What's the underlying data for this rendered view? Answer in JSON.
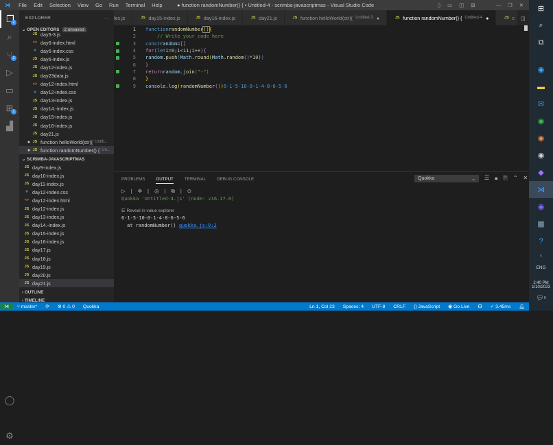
{
  "titlebar": {
    "menus": [
      "File",
      "Edit",
      "Selection",
      "View",
      "Go",
      "Run",
      "Terminal",
      "Help"
    ],
    "title": "● function randomNumber() { • Untitled-4 - scrimba-javascriptmas - Visual Studio Code"
  },
  "activity": {
    "explorer_badge": "2",
    "scm_badge": "1",
    "extensions_badge": "1"
  },
  "sidebar": {
    "title": "EXPLORER",
    "open_editors": "OPEN EDITORS",
    "unsaved": "2 unsaved",
    "open_files": [
      {
        "name": "day5-3.js",
        "type": "js"
      },
      {
        "name": "day6-index.html",
        "type": "html"
      },
      {
        "name": "day6-index.css",
        "type": "css"
      },
      {
        "name": "day6-index.js",
        "type": "js"
      },
      {
        "name": "day12-index.js",
        "type": "js"
      },
      {
        "name": "day23data.js",
        "type": "js"
      },
      {
        "name": "day12-index.html",
        "type": "html"
      },
      {
        "name": "day12-index.css",
        "type": "css"
      },
      {
        "name": "day13-index.js",
        "type": "js"
      },
      {
        "name": "day14.-index.js",
        "type": "js"
      },
      {
        "name": "day15-index.js",
        "type": "js"
      },
      {
        "name": "day16-index.js",
        "type": "js"
      },
      {
        "name": "day21.js",
        "type": "js"
      },
      {
        "name": "function helloWorld(str){",
        "type": "js",
        "sub": "Untitl...",
        "dirty": true
      },
      {
        "name": "function randomNumber() {",
        "type": "js",
        "sub": "Un...",
        "dirty": true
      }
    ],
    "project": "SCRIMBA-JAVASCRIPTMAS",
    "project_files": [
      {
        "name": "day9-index.js",
        "type": "js"
      },
      {
        "name": "day10-index.js",
        "type": "js"
      },
      {
        "name": "day11-index.js",
        "type": "js"
      },
      {
        "name": "day12-index.css",
        "type": "css"
      },
      {
        "name": "day12-index.html",
        "type": "html"
      },
      {
        "name": "day12-index.js",
        "type": "js"
      },
      {
        "name": "day13-index.js",
        "type": "js"
      },
      {
        "name": "day14.-index.js",
        "type": "js"
      },
      {
        "name": "day15-index.js",
        "type": "js"
      },
      {
        "name": "day16-index.js",
        "type": "js"
      },
      {
        "name": "day17.js",
        "type": "js"
      },
      {
        "name": "day18.js",
        "type": "js"
      },
      {
        "name": "day19.js",
        "type": "js"
      },
      {
        "name": "day20.js",
        "type": "js"
      },
      {
        "name": "day21.js",
        "type": "js"
      }
    ],
    "outline": "OUTLINE",
    "timeline": "TIMELINE"
  },
  "tabs": [
    {
      "label": "lex.js"
    },
    {
      "label": "day15-index.js"
    },
    {
      "label": "day16-index.js"
    },
    {
      "label": "day21.js"
    },
    {
      "label": "function helloWorld(str){",
      "sub": "Untitled-3"
    },
    {
      "label": "function randomNumber() {",
      "sub": "Untitled-4"
    },
    {
      "label": "c"
    }
  ],
  "editor": {
    "line_numbers": [
      "1",
      "2",
      "3",
      "4",
      "5",
      "6",
      "7",
      "8",
      "9"
    ],
    "inline_result": "6-1-5-10-0-1-4-8-6-5-6"
  },
  "panel": {
    "tabs": [
      "PROBLEMS",
      "OUTPUT",
      "TERMINAL",
      "DEBUG CONSOLE"
    ],
    "channel": "Quokka",
    "header": "Quokka 'Untitled-4.js' (node: v16.17.0)",
    "reveal": "Reveal in value explorer",
    "result": "6-1-5-10-0-1-4-8-6-5-6",
    "at": "at randomNumber()",
    "link": "quokka.js:9:2"
  },
  "status": {
    "branch": "master*",
    "errors": "0",
    "warnings": "0",
    "quokka": "Quokka",
    "position": "Ln 1, Col 23",
    "spaces": "Spaces: 4",
    "encoding": "UTF-8",
    "eol": "CRLF",
    "language": "JavaScript",
    "golive": "Go Live",
    "timing": "✓ 3.45ms"
  },
  "taskbar": {
    "lang": "ENG",
    "time": "2:40 PM",
    "date": "1/10/2023",
    "notif": "9"
  }
}
